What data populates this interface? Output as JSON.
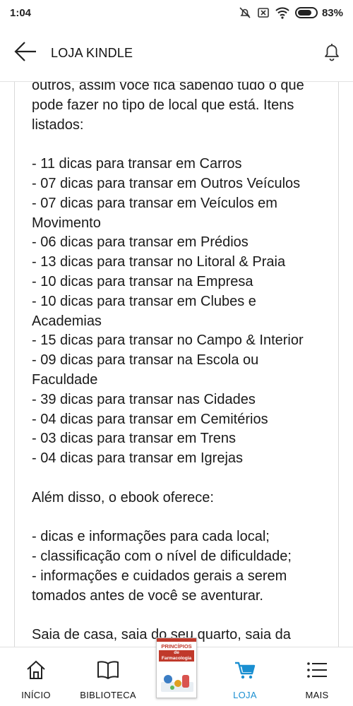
{
  "status_bar": {
    "time": "1:04",
    "battery": "83%",
    "battery_level": 0.83
  },
  "header": {
    "title": "LOJA KINDLE"
  },
  "content": {
    "lines": [
      "outros, assim você fica sabendo tudo o que",
      "pode fazer no tipo de local que está. Itens",
      "listados:",
      "",
      "- 11 dicas para transar em Carros",
      "- 07 dicas para transar em Outros Veículos",
      "- 07 dicas para transar em Veículos em",
      "Movimento",
      "- 06 dicas para transar em Prédios",
      "- 13 dicas para transar no Litoral & Praia",
      "- 10 dicas para transar na Empresa",
      "- 10 dicas para transar em Clubes e",
      "Academias",
      "- 15 dicas para transar no Campo & Interior",
      "- 09 dicas para transar na Escola ou",
      "Faculdade",
      "- 39 dicas para transar nas Cidades",
      "- 04 dicas para transar em Cemitérios",
      "- 03 dicas para transar em Trens",
      "- 04 dicas para transar em Igrejas",
      "",
      "Além disso, o ebook oferece:",
      "",
      "- dicas e informações para cada local;",
      "- classificação com o nível de dificuldade;",
      "- informações e cuidados gerais a serem",
      "tomados antes de você se aventurar.",
      "",
      "Saia de casa, saia do seu quarto, saia da"
    ]
  },
  "bottom_nav": {
    "items": [
      {
        "label": "INÍCIO",
        "icon": "home-icon"
      },
      {
        "label": "BIBLIOTECA",
        "icon": "book-icon"
      },
      {
        "label": "LOJA",
        "icon": "cart-icon"
      },
      {
        "label": "MAIS",
        "icon": "menu-icon"
      }
    ],
    "book": {
      "title": "PRINCÍPIOS",
      "subtitle": "de Farmacologia"
    }
  },
  "colors": {
    "accent": "#1a8fd1",
    "book_red": "#c0392b"
  }
}
